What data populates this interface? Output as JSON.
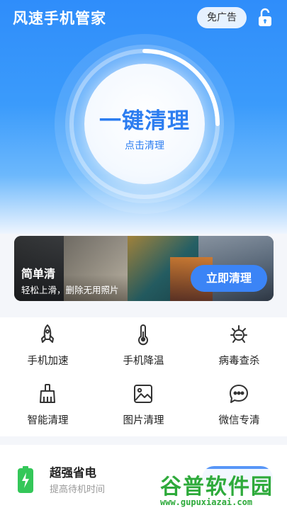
{
  "header": {
    "app_title": "风速手机管家",
    "ad_free_label": "免广告",
    "lock_icon": "unlock-icon"
  },
  "hero": {
    "main_label": "一键清理",
    "sub_label": "点击清理",
    "accent": "#2c7df0"
  },
  "banner": {
    "title": "简单清",
    "subtitle": "轻松上滑，删除无用照片",
    "button_label": "立即清理",
    "button_color": "#3b84f6"
  },
  "features": [
    {
      "label": "手机加速",
      "icon": "rocket-icon"
    },
    {
      "label": "手机降温",
      "icon": "thermometer-icon"
    },
    {
      "label": "病毒查杀",
      "icon": "virus-icon"
    },
    {
      "label": "智能清理",
      "icon": "broom-icon"
    },
    {
      "label": "图片清理",
      "icon": "image-icon"
    },
    {
      "label": "微信专清",
      "icon": "chat-bubble-icon"
    }
  ],
  "bottom_card": {
    "title": "超强省电",
    "subtitle": "提高待机时间",
    "icon": "battery-charging-icon"
  },
  "watermark": {
    "name": "谷普软件园",
    "url": "www.gupuxiazai.com"
  }
}
